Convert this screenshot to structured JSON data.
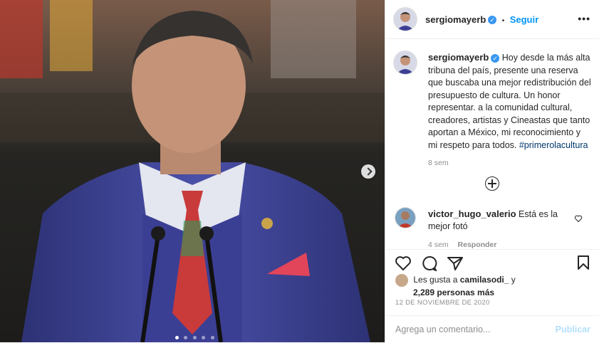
{
  "post": {
    "username": "sergiomayerb",
    "verified_mark": "✓",
    "follow_separator": "•",
    "follow_label": "Seguir",
    "more_label": "•••",
    "caption_text": "Hoy desde la más alta tribuna del país, presente una reserva que buscaba una mejor redistribución del presupuesto de cultura. Un honor representar. a la comunidad cultural, creadores, artistas y Cineastas que tanto aportan a México, mi reconocimiento y mi respeto para todos.",
    "hashtag": "#primerolacultura",
    "caption_time": "8 sem"
  },
  "comment": {
    "username": "victor_hugo_valerio",
    "text": "Está es la mejor fotó",
    "time": "4 sem",
    "reply_label": "Responder"
  },
  "likes": {
    "prefix": "Les gusta a",
    "user": "camilasodi_",
    "conj": "y",
    "count_text": "2,289 personas más"
  },
  "date": "12 DE NOVIEMBRE DE 2020",
  "comment_input": {
    "placeholder": "Agrega un comentario...",
    "publish_label": "Publicar"
  },
  "carousel": {
    "slide_count": 5,
    "active_index": 0
  },
  "colors": {
    "accent": "#0095f6",
    "hashtag": "#00376b",
    "suit": "#3a3f8c"
  }
}
